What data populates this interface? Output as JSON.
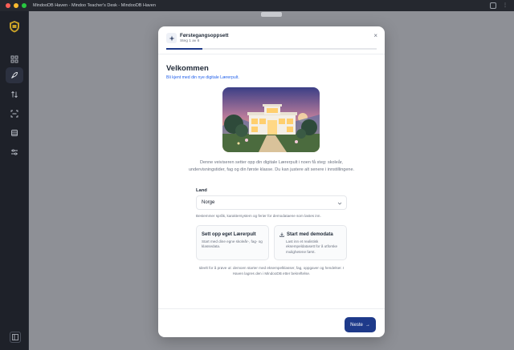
{
  "window": {
    "title": "MindooDB Haven - Mindoo Teacher's Desk - MindooDB Haven"
  },
  "sidebar": {
    "items": [
      {
        "icon": "grid-icon",
        "active": false
      },
      {
        "icon": "rocket-icon",
        "active": true
      },
      {
        "icon": "sort-arrows-icon",
        "active": false
      },
      {
        "icon": "scan-icon",
        "active": false
      },
      {
        "icon": "database-icon",
        "active": false
      },
      {
        "icon": "sliders-icon",
        "active": false
      }
    ],
    "bottom_icon": "sidebar-toggle-icon"
  },
  "modal": {
    "title": "Førstegangsoppsett",
    "step": "Steg 1 av 6",
    "progress": 0.17,
    "heading": "Velkommen",
    "subheading": "Bli kjent med din nye digitale Lærerpult.",
    "description": "Denne veiviseren setter opp din digitale Lærerpult i noen få steg: skoleår, undervisningstider, fag og din første klasse. Du kan justere alt senere i innstillingene.",
    "land_label": "Land",
    "land_value": "Norge",
    "land_hint": "Bestemmer språk, karaktersystem og ferier for demodataene som lastes inn.",
    "option_own": {
      "title": "Sett opp eget Lærerpult",
      "desc": "Start med dine egne skoleår-, fag- og klassedata."
    },
    "option_demo": {
      "title": "Start med demodata",
      "desc": "Last inn et realistisk eksempeldatasett for å utforske mulighetene først."
    },
    "footnote": "Ideelt for å prøve ut: demoen starter med eksempelklasser, fag, oppgaver og hendelser. I Haven lagres den i MindooDB etter bekreftelse.",
    "next_label": "Neste"
  },
  "colors": {
    "accent": "#1e3a8a",
    "link": "#2563eb"
  }
}
